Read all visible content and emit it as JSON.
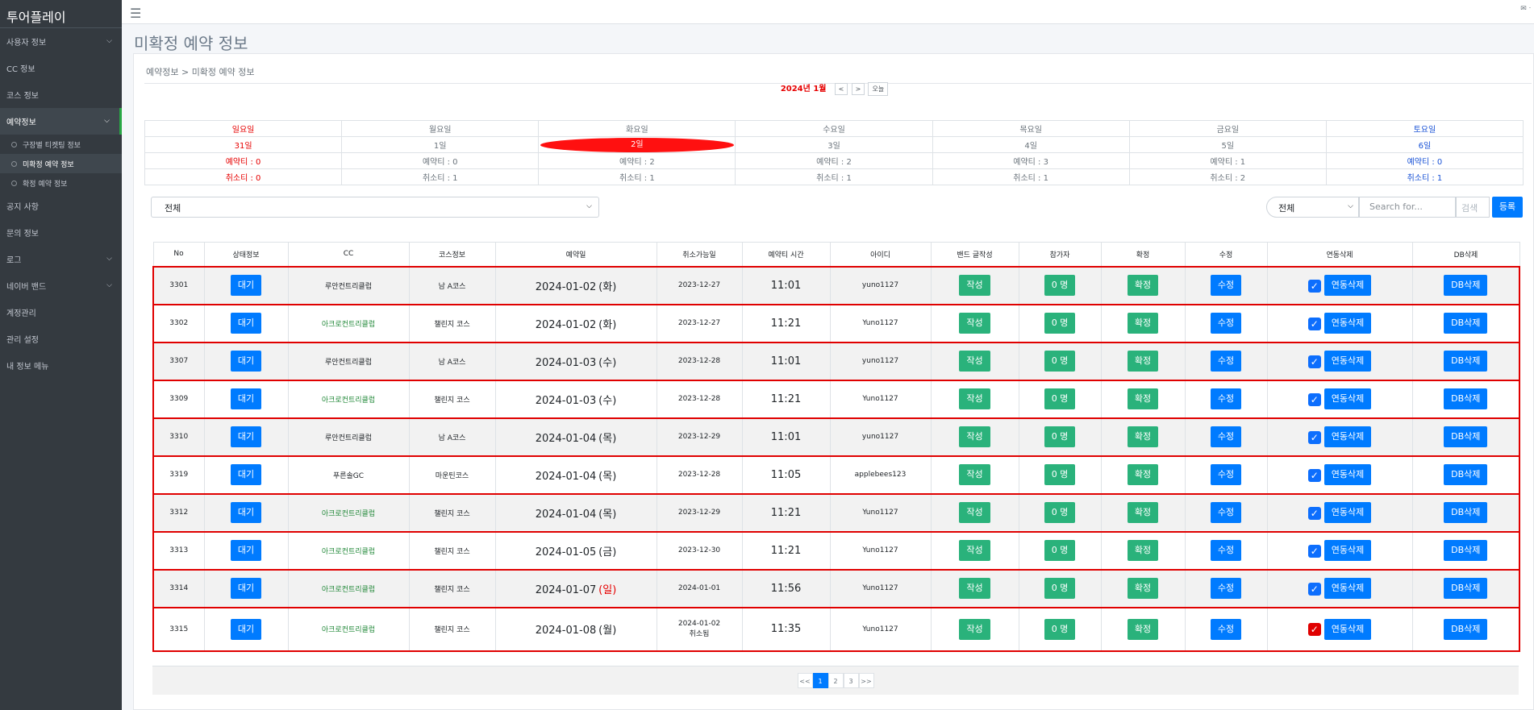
{
  "app": {
    "brand": "투어플레이",
    "top_right": "✉ ᐧ"
  },
  "sidebar": {
    "items": [
      {
        "label": "사용자 정보",
        "chevron": true
      },
      {
        "label": "CC 정보",
        "chevron": false
      },
      {
        "label": "코스 정보",
        "chevron": false
      },
      {
        "label": "예약정보",
        "chevron": true,
        "active": true
      },
      {
        "label": "공지 사항",
        "chevron": false
      },
      {
        "label": "문의 정보",
        "chevron": false
      },
      {
        "label": "로그",
        "chevron": true
      },
      {
        "label": "네이버 밴드",
        "chevron": true
      },
      {
        "label": "계정관리",
        "chevron": false
      },
      {
        "label": "관리 설정",
        "chevron": false
      },
      {
        "label": "내 정보 메뉴",
        "chevron": false
      }
    ],
    "sub_items": [
      "구장별 티켓팅 정보",
      "미확정 예약 정보",
      "확정 예약 정보"
    ]
  },
  "page": {
    "title": "미확정 예약 정보",
    "breadcrumb": "예약정보 > 미확정 예약 정보"
  },
  "calendar": {
    "month": "2024년 1월",
    "prev": "<",
    "next": ">",
    "today": "오늘",
    "days": [
      {
        "name": "일요일",
        "date": "31일",
        "reserve": "예약티 : 0",
        "cancel": "취소티 : 0"
      },
      {
        "name": "월요일",
        "date": "1일",
        "reserve": "예약티 : 0",
        "cancel": "취소티 : 1"
      },
      {
        "name": "화요일",
        "date": "2일",
        "reserve": "예약티 : 2",
        "cancel": "취소티 : 1"
      },
      {
        "name": "수요일",
        "date": "3일",
        "reserve": "예약티 : 2",
        "cancel": "취소티 : 1"
      },
      {
        "name": "목요일",
        "date": "4일",
        "reserve": "예약티 : 3",
        "cancel": "취소티 : 1"
      },
      {
        "name": "금요일",
        "date": "5일",
        "reserve": "예약티 : 1",
        "cancel": "취소티 : 2"
      },
      {
        "name": "토요일",
        "date": "6일",
        "reserve": "예약티 : 0",
        "cancel": "취소티 : 1"
      }
    ]
  },
  "filters": {
    "status_select": "전체",
    "search_select": "전체",
    "search_placeholder": "Search for...",
    "search_button": "검색",
    "register_button": "등록"
  },
  "table": {
    "headers": [
      "No",
      "상태정보",
      "CC",
      "코스정보",
      "예약일",
      "취소가능일",
      "예약티 시간",
      "아이디",
      "밴드 글작성",
      "참가자",
      "확정",
      "수정",
      "연동삭제",
      "DB삭제"
    ],
    "rows": [
      {
        "no": "3301",
        "status": "대기",
        "cc": "루안컨트리클럽",
        "cc_green": false,
        "course": "남 A코스",
        "date": "2024-01-02",
        "weekday": "(화)",
        "weekday_red": false,
        "cancel_date": "2023-12-27",
        "cancel_note": "",
        "time": "11:01",
        "user_id": "yuno1127",
        "band": "작성",
        "participants": "0 명",
        "confirm": "확정",
        "edit": "수정",
        "link_delete": "연동삭제",
        "db_delete": "DB삭제"
      },
      {
        "no": "3302",
        "status": "대기",
        "cc": "아크로컨트리클럽",
        "cc_green": true,
        "course": "챌린지 코스",
        "date": "2024-01-02",
        "weekday": "(화)",
        "weekday_red": false,
        "cancel_date": "2023-12-27",
        "cancel_note": "",
        "time": "11:21",
        "user_id": "Yuno1127",
        "band": "작성",
        "participants": "0 명",
        "confirm": "확정",
        "edit": "수정",
        "link_delete": "연동삭제",
        "db_delete": "DB삭제"
      },
      {
        "no": "3307",
        "status": "대기",
        "cc": "루안컨트리클럽",
        "cc_green": false,
        "course": "남 A코스",
        "date": "2024-01-03",
        "weekday": "(수)",
        "weekday_red": false,
        "cancel_date": "2023-12-28",
        "cancel_note": "",
        "time": "11:01",
        "user_id": "yuno1127",
        "band": "작성",
        "participants": "0 명",
        "confirm": "확정",
        "edit": "수정",
        "link_delete": "연동삭제",
        "db_delete": "DB삭제"
      },
      {
        "no": "3309",
        "status": "대기",
        "cc": "아크로컨트리클럽",
        "cc_green": true,
        "course": "챌린지 코스",
        "date": "2024-01-03",
        "weekday": "(수)",
        "weekday_red": false,
        "cancel_date": "2023-12-28",
        "cancel_note": "",
        "time": "11:21",
        "user_id": "Yuno1127",
        "band": "작성",
        "participants": "0 명",
        "confirm": "확정",
        "edit": "수정",
        "link_delete": "연동삭제",
        "db_delete": "DB삭제"
      },
      {
        "no": "3310",
        "status": "대기",
        "cc": "루안컨트리클럽",
        "cc_green": false,
        "course": "남 A코스",
        "date": "2024-01-04",
        "weekday": "(목)",
        "weekday_red": false,
        "cancel_date": "2023-12-29",
        "cancel_note": "",
        "time": "11:01",
        "user_id": "yuno1127",
        "band": "작성",
        "participants": "0 명",
        "confirm": "확정",
        "edit": "수정",
        "link_delete": "연동삭제",
        "db_delete": "DB삭제"
      },
      {
        "no": "3319",
        "status": "대기",
        "cc": "푸른솔GC",
        "cc_green": false,
        "course": "마운틴코스",
        "date": "2024-01-04",
        "weekday": "(목)",
        "weekday_red": false,
        "cancel_date": "2023-12-28",
        "cancel_note": "",
        "time": "11:05",
        "user_id": "applebees123",
        "band": "작성",
        "participants": "0 명",
        "confirm": "확정",
        "edit": "수정",
        "link_delete": "연동삭제",
        "db_delete": "DB삭제"
      },
      {
        "no": "3312",
        "status": "대기",
        "cc": "아크로컨트리클럽",
        "cc_green": true,
        "course": "챌린지 코스",
        "date": "2024-01-04",
        "weekday": "(목)",
        "weekday_red": false,
        "cancel_date": "2023-12-29",
        "cancel_note": "",
        "time": "11:21",
        "user_id": "Yuno1127",
        "band": "작성",
        "participants": "0 명",
        "confirm": "확정",
        "edit": "수정",
        "link_delete": "연동삭제",
        "db_delete": "DB삭제"
      },
      {
        "no": "3313",
        "status": "대기",
        "cc": "아크로컨트리클럽",
        "cc_green": true,
        "course": "챌린지 코스",
        "date": "2024-01-05",
        "weekday": "(금)",
        "weekday_red": false,
        "cancel_date": "2023-12-30",
        "cancel_note": "",
        "time": "11:21",
        "user_id": "Yuno1127",
        "band": "작성",
        "participants": "0 명",
        "confirm": "확정",
        "edit": "수정",
        "link_delete": "연동삭제",
        "db_delete": "DB삭제"
      },
      {
        "no": "3314",
        "status": "대기",
        "cc": "아크로컨트리클럽",
        "cc_green": true,
        "course": "챌린지 코스",
        "date": "2024-01-07",
        "weekday": "(일)",
        "weekday_red": true,
        "cancel_date": "2024-01-01",
        "cancel_note": "",
        "time": "11:56",
        "user_id": "Yuno1127",
        "band": "작성",
        "participants": "0 명",
        "confirm": "확정",
        "edit": "수정",
        "link_delete": "연동삭제",
        "db_delete": "DB삭제"
      },
      {
        "no": "3315",
        "status": "대기",
        "cc": "아크로컨트리클럽",
        "cc_green": true,
        "course": "챌린지 코스",
        "date": "2024-01-08",
        "weekday": "(월)",
        "weekday_red": false,
        "cancel_date": "2024-01-02",
        "cancel_note": "취소됨",
        "time": "11:35",
        "user_id": "Yuno1127",
        "band": "작성",
        "participants": "0 명",
        "confirm": "확정",
        "edit": "수정",
        "link_delete": "연동삭제",
        "db_delete": "DB삭제"
      }
    ]
  },
  "pagination": {
    "first": "<<",
    "pages": [
      "1",
      "2",
      "3"
    ],
    "current": "1",
    "last": ">>"
  },
  "colors": {
    "sidebar_bg": "#343a40",
    "primary": "#007bff",
    "success": "#2ab27b",
    "teal": "#20c997",
    "highlight": "#e00000"
  }
}
